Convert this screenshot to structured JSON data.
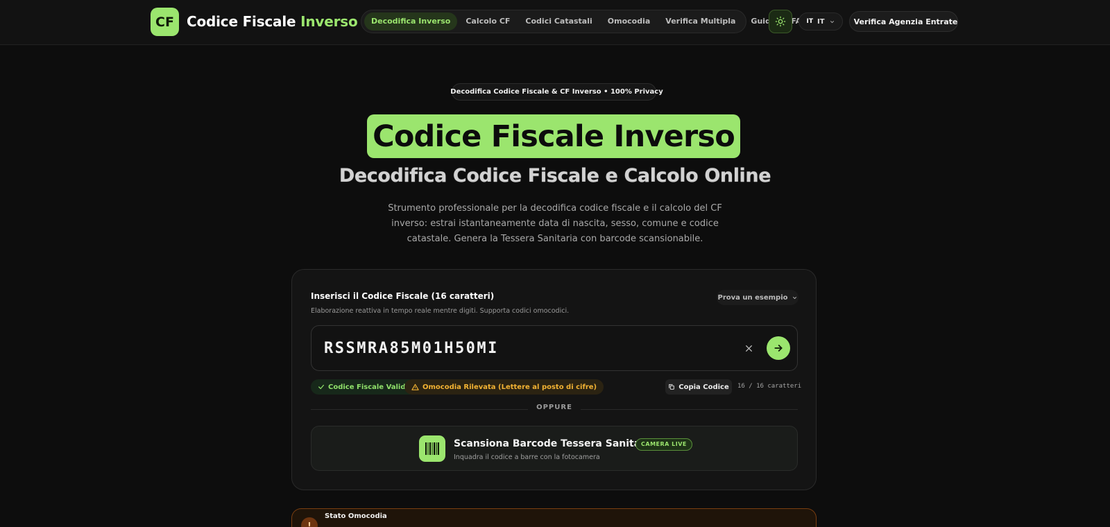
{
  "brand": {
    "logo": "CF",
    "name": "Codice Fiscale",
    "name_accent": "Inverso"
  },
  "nav": {
    "items": [
      {
        "label": "Decodifica Inverso",
        "active": true
      },
      {
        "label": "Calcolo CF",
        "active": false
      },
      {
        "label": "Codici Catastali",
        "active": false
      },
      {
        "label": "Omocodia",
        "active": false
      },
      {
        "label": "Verifica Multipla",
        "active": false
      },
      {
        "label": "Guide",
        "active": false
      },
      {
        "label": "FAQ",
        "active": false
      }
    ]
  },
  "header_actions": {
    "theme_icon": "sun-icon",
    "lang_flag": "IT",
    "lang_label": "IT",
    "verify_label": "Verifica Agenzia Entrate"
  },
  "hero": {
    "pill": "Decodifica Codice Fiscale & CF Inverso • 100% Privacy",
    "title": "Codice Fiscale Inverso",
    "subtitle": "Decodifica Codice Fiscale e Calcolo Online",
    "description": "Strumento professionale per la decodifica codice fiscale e il calcolo del CF inverso: estrai istantaneamente data di nascita, sesso, comune e codice catastale. Genera la Tessera Sanitaria con barcode scansionabile."
  },
  "decoder": {
    "title": "Inserisci il Codice Fiscale (16 caratteri)",
    "hint": "Elaborazione reattiva in tempo reale mentre digiti. Supporta codici omocodici.",
    "example_label": "Prova un esempio",
    "input_value": "RSSMRA85M01H50MI",
    "badge_valid": "Codice Fiscale Valido",
    "badge_warning": "Omocodia Rilevata (Lettere al posto di cifre)",
    "copy_label": "Copia Codice",
    "char_count": "16 / 16 caratteri",
    "divider": "OPPURE",
    "scan_title": "Scansiona Barcode Tessera Sanitaria",
    "scan_badge": "CAMERA LIVE",
    "scan_subtitle": "Inquadra il codice a barre con la fotocamera"
  },
  "omocodia": {
    "icon": "!",
    "title": "Stato Omocodia"
  },
  "colors": {
    "accent": "#9be56e",
    "background": "#0d0d0d",
    "warning": "#f2b233"
  }
}
